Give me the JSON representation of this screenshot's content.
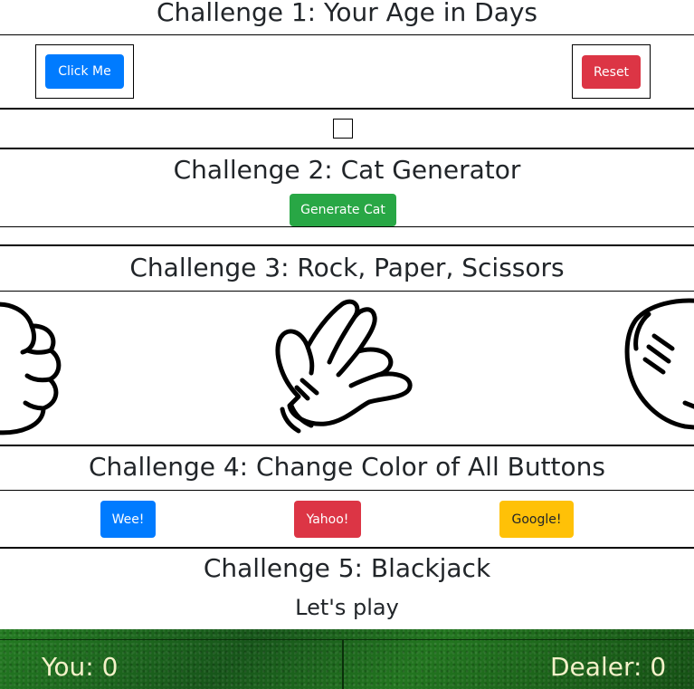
{
  "challenge1": {
    "title": "Challenge 1: Your Age in Days",
    "click_label": "Click Me",
    "reset_label": "Reset"
  },
  "challenge2": {
    "title": "Challenge 2: Cat Generator",
    "generate_label": "Generate Cat"
  },
  "challenge3": {
    "title": "Challenge 3: Rock, Paper, Scissors",
    "choices": [
      "rock",
      "paper",
      "scissors"
    ]
  },
  "challenge4": {
    "title": "Challenge 4: Change Color of All Buttons",
    "buttons": [
      "Wee!",
      "Yahoo!",
      "Google!"
    ]
  },
  "challenge5": {
    "title": "Challenge 5: Blackjack",
    "status": "Let's play",
    "you_label": "You:",
    "you_score": "0",
    "dealer_label": "Dealer:",
    "dealer_score": "0"
  },
  "colors": {
    "primary": "#007bff",
    "danger": "#dc3545",
    "success": "#28a745",
    "warning": "#ffc107",
    "felt": "#1e6b1c",
    "score_text": "#f3f1c9"
  }
}
